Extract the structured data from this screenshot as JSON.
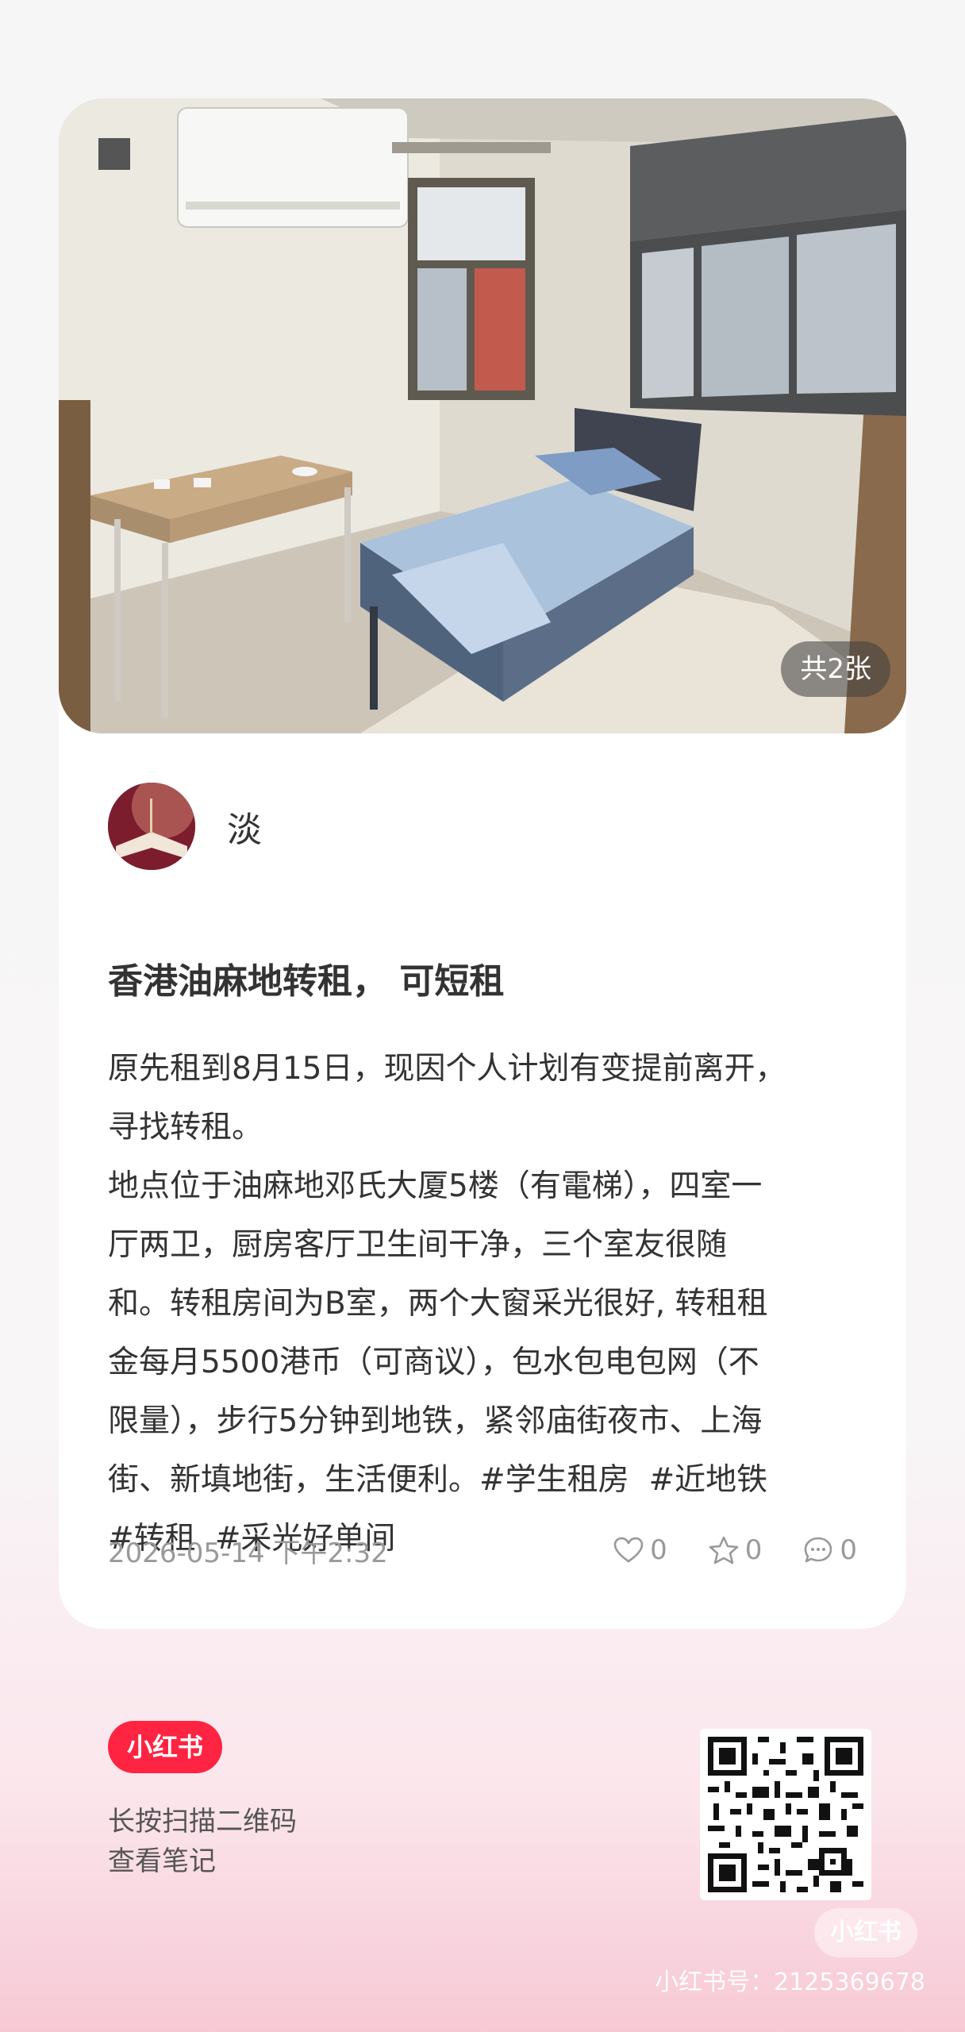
{
  "image": {
    "count_label": "共2张"
  },
  "author": {
    "name": "淡"
  },
  "post": {
    "title": "香港油麻地转租， 可短租",
    "body": "原先租到8月15日，现因个人计划有变提前离开，\n寻找转租。\n地点位于油麻地邓氏大厦5楼（有電梯），四室一\n厅两卫，厨房客厅卫生间干净，三个室友很随\n和。转租房间为B室，两个大窗采光很好, 转租租\n金每月5500港币（可商议），包水包电包网（不\n限量），步行5分钟到地铁，紧邻庙街夜市、上海\n街、新填地街，生活便利。#学生租房  #近地铁",
    "tags_line2": [
      "#转租",
      "#采光好单间"
    ],
    "date": "2026-05-14 下午2:32",
    "likes": "0",
    "collects": "0",
    "comments": "0"
  },
  "footer": {
    "brand": "小红书",
    "scan_line1": "长按扫描二维码",
    "scan_line2": "查看笔记",
    "watermark_brand": "小红书",
    "watermark_id": "小红书号：2125369678"
  },
  "colors": {
    "brand_red": "#ff2442",
    "meta_gray": "#999999"
  },
  "icons": [
    "heart-icon",
    "star-icon",
    "comment-icon",
    "qr-code"
  ]
}
